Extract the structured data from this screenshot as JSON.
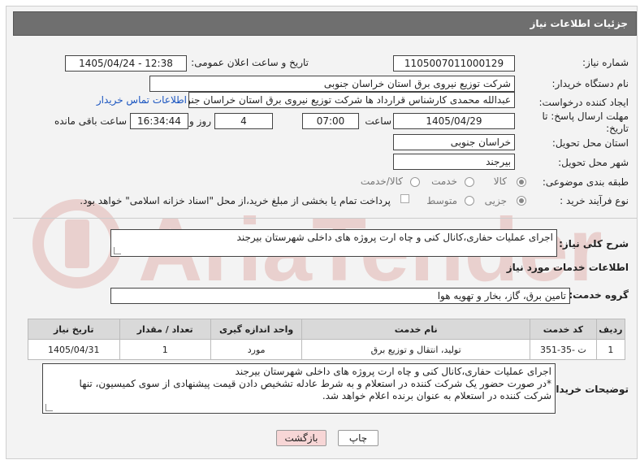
{
  "header": {
    "title": "جزئیات اطلاعات نیاز"
  },
  "fields": {
    "need_number_label": "شماره نیاز:",
    "need_number": "1105007011000129",
    "announce_label": "تاریخ و ساعت اعلان عمومی:",
    "announce_value": "1405/04/24 - 12:38",
    "buyer_label": "نام دستگاه خریدار:",
    "buyer_value": "شرکت توزیع نیروی برق استان خراسان جنوبی",
    "creator_label": "ایجاد کننده درخواست:",
    "creator_value": "عبدالله محمدی کارشناس قرارداد ها شرکت توزیع نیروی برق استان خراسان جنو",
    "contact_link": "اطلاعات تماس خریدار",
    "deadline_label": "مهلت ارسال پاسخ: تا تاریخ:",
    "deadline_date": "1405/04/29",
    "time_label": "ساعت",
    "deadline_time": "07:00",
    "days_value": "4",
    "days_label": "روز و",
    "remaining_time": "16:34:44",
    "remaining_label": "ساعت باقی مانده",
    "province_label": "استان محل تحویل:",
    "province_value": "خراسان جنوبی",
    "city_label": "شهر محل تحویل:",
    "city_value": "بیرجند",
    "category_label": "طبقه بندی موضوعی:",
    "category_options": [
      "کالا",
      "خدمت",
      "کالا/خدمت"
    ],
    "process_label": "نوع فرآیند خرید :",
    "process_options": [
      "جزیی",
      "متوسط"
    ],
    "payment_note": "پرداخت تمام یا بخشی از مبلغ خرید،از محل \"اسناد خزانه اسلامی\" خواهد بود."
  },
  "summary": {
    "label": "شرح کلی نیاز:",
    "value": "اجرای عملیات حفاری،کانال کنی و چاه ارت پروژه های داخلی شهرستان بیرجند"
  },
  "services": {
    "section_title": "اطلاعات خدمات مورد نیاز",
    "group_label": "گروه خدمت:",
    "group_value": "تامین برق، گاز، بخار و تهویه هوا",
    "columns": [
      "ردیف",
      "کد خدمت",
      "نام خدمت",
      "واحد اندازه گیری",
      "تعداد / مقدار",
      "تاریخ نیاز"
    ],
    "rows": [
      [
        "1",
        "ت -35-351",
        "تولید، انتقال و توزیع برق",
        "مورد",
        "1",
        "1405/04/31"
      ]
    ]
  },
  "buyer_notes": {
    "label": "توضیحات خریدار:",
    "lines": [
      "اجرای عملیات حفاری،کانال کنی و چاه ارت پروژه های داخلی شهرستان بیرجند",
      "*در صورت حضور یک شرکت کننده در استعلام و به شرط عادله تشخیص دادن قیمت پیشنهادی از سوی کمیسیون، تنها",
      "شرکت کننده در استعلام به عنوان برنده اعلام خواهد شد."
    ]
  },
  "buttons": {
    "print": "چاپ",
    "back": "بازگشت"
  },
  "watermark": {
    "text": "AriaTender.net"
  },
  "colors": {
    "header_bg": "#6f6f6f",
    "back_btn_bg": "#f7d6d6",
    "watermark": "#c0392b"
  }
}
